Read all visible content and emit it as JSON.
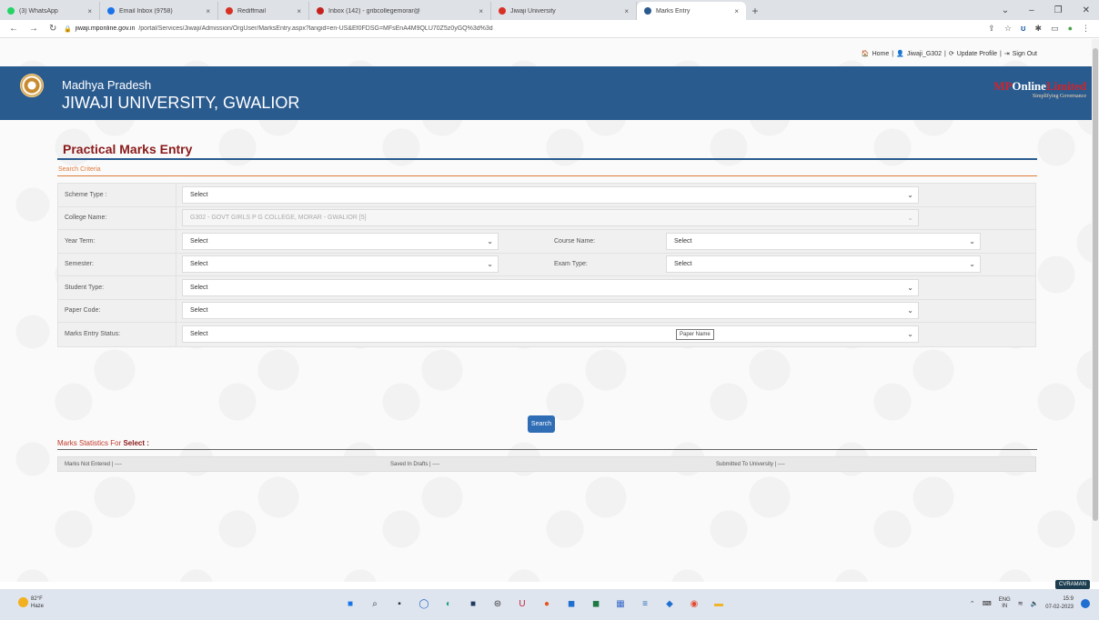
{
  "browser": {
    "tabs": [
      {
        "title": "(3) WhatsApp",
        "color": "#25d366",
        "active": false
      },
      {
        "title": "Email Inbox (9758)",
        "color": "#1a73e8",
        "active": false
      },
      {
        "title": "Rediffmail",
        "color": "#d93025",
        "active": false
      },
      {
        "title": "Inbox (142) - gribcollegemorar@",
        "color": "#c5221f",
        "active": false
      },
      {
        "title": "Jiwaji University",
        "color": "#d93025",
        "active": false
      },
      {
        "title": "Marks Entry",
        "color": "#2a5b8f",
        "active": true
      }
    ],
    "url_domain": "jiwaji.mponline.gov.in",
    "url_path": "/portal/Services/Jiwaji/Admission/OrgUser/MarksEntry.aspx?langid=en-US&Ef0FDSG=MFsEnA4M9QLU70Z5z0yGQ%3d%3d"
  },
  "header": {
    "links": [
      "Home",
      "Jiwaji_G302",
      "Update Profile",
      "Sign Out"
    ],
    "state": "Madhya Pradesh",
    "university": "JIWAJI UNIVERSITY, GWALIOR",
    "logo_mp": "MP",
    "logo_online": "Online",
    "logo_limited": "Limited",
    "logo_tagline": "Simplifying Governance"
  },
  "page": {
    "title": "Practical Marks Entry",
    "search_criteria": "Search Criteria"
  },
  "form": {
    "scheme_type_label": "Scheme Type :",
    "scheme_type_value": "Select",
    "college_name_label": "College Name:",
    "college_name_value": "G302 - GOVT GIRLS P G COLLEGE, MORAR - GWALIOR [5]",
    "year_term_label": "Year Term:",
    "year_term_value": "Select",
    "course_name_label": "Course Name:",
    "course_name_value": "Select",
    "semester_label": "Semester:",
    "semester_value": "Select",
    "exam_type_label": "Exam Type:",
    "exam_type_value": "Select",
    "student_type_label": "Student Type:",
    "student_type_value": "Select",
    "paper_code_label": "Paper Code:",
    "paper_code_value": "Select",
    "marks_entry_status_label": "Marks Entry Status:",
    "marks_entry_status_value": "Select",
    "tooltip": "Paper Name",
    "search_button": "Search"
  },
  "stats": {
    "title_prefix": "Marks Statistics For",
    "title_value": "Select :",
    "not_entered": "Marks Not Entered | ----",
    "saved_drafts": "Saved In Drafts | ----",
    "submitted": "Submitted To University | ----"
  },
  "taskbar": {
    "temp": "82°F",
    "condition": "Haze",
    "lang": "ENG",
    "region": "IN",
    "time": "15:9",
    "date": "07-02-2023",
    "badge": "CVRAMAN"
  }
}
